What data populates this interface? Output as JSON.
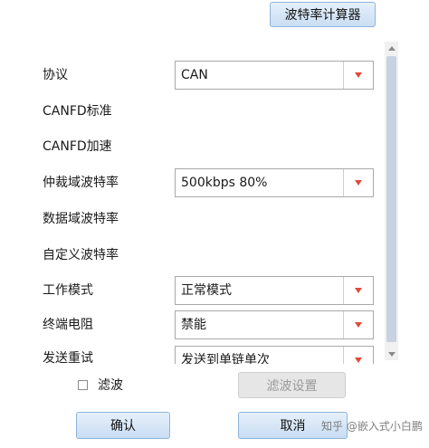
{
  "header": {
    "baud_calculator_label": "波特率计算器"
  },
  "form": {
    "rows": [
      {
        "label": "协议",
        "value": "CAN"
      },
      {
        "label": "CANFD标准"
      },
      {
        "label": "CANFD加速"
      },
      {
        "label": "仲裁域波特率",
        "value": "500kbps 80%"
      },
      {
        "label": "数据域波特率"
      },
      {
        "label": "自定义波特率"
      },
      {
        "label": "工作模式",
        "value": "正常模式"
      },
      {
        "label": "终端电阻",
        "value": "禁能"
      },
      {
        "label": "发送重试",
        "value": "发送到单链单次"
      }
    ]
  },
  "filter": {
    "label": "滤波",
    "settings_label": "滤波设置",
    "checked": false
  },
  "footer": {
    "ok_label": "确认",
    "cancel_label": "取消"
  },
  "watermark": "知乎 @嵌入式小白鹏",
  "colors": {
    "arrow": "#e04a3a",
    "button_top": "#e6f0fb",
    "button_bottom": "#c9ddf3",
    "border": "#8eb4de"
  }
}
